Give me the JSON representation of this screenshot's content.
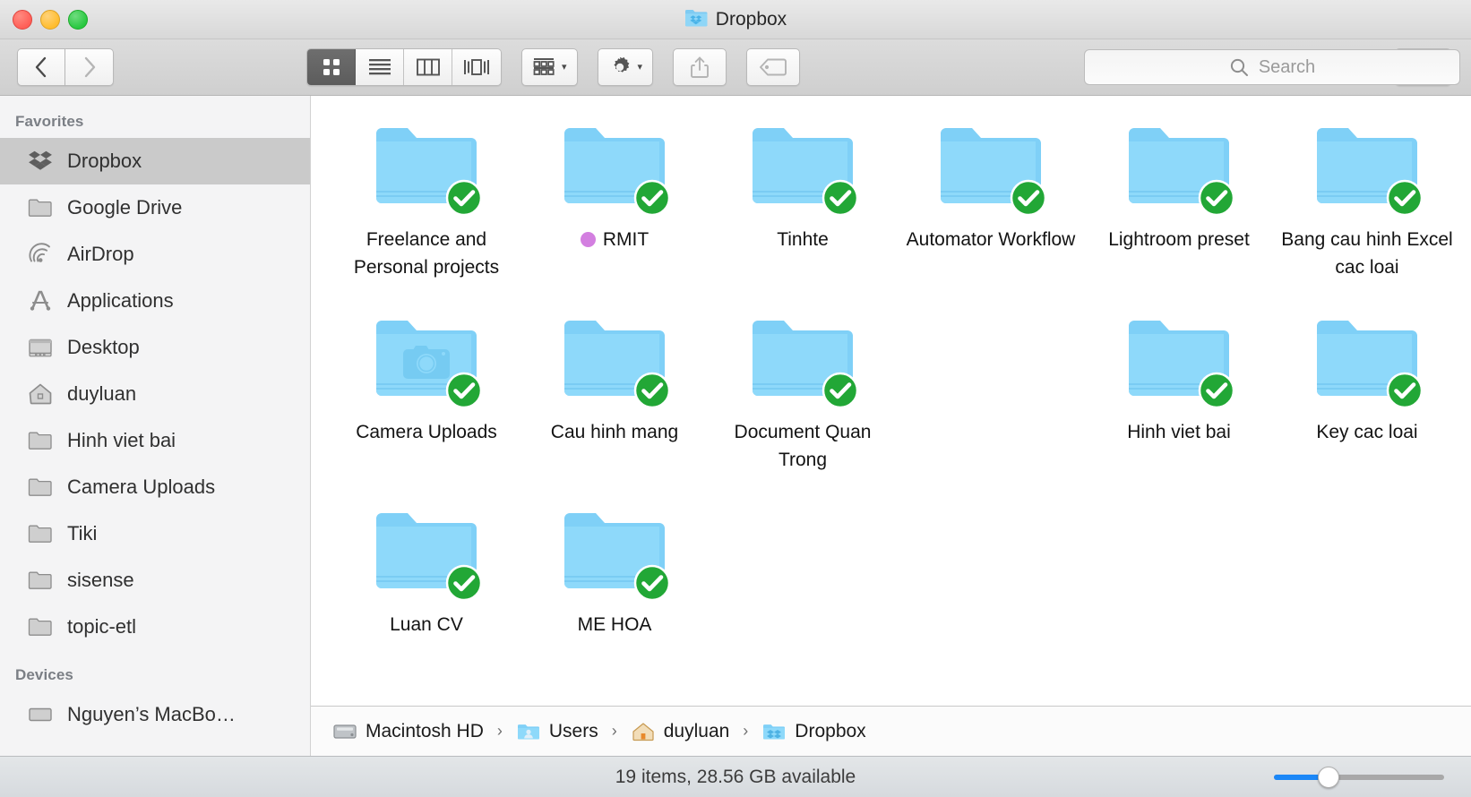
{
  "window": {
    "title": "Dropbox",
    "title_icon": "dropbox-folder-icon",
    "traffic_lights": [
      {
        "name": "close-button",
        "color": "#ff5f57"
      },
      {
        "name": "minimize-button",
        "color": "#ffbd2e"
      },
      {
        "name": "zoom-button",
        "color": "#28c840"
      }
    ]
  },
  "toolbar": {
    "back_icon": "chevron-left-icon",
    "forward_icon": "chevron-right-icon",
    "view_modes": [
      {
        "name": "icon-view",
        "icon": "grid-icon",
        "active": true
      },
      {
        "name": "list-view",
        "icon": "list-icon",
        "active": false
      },
      {
        "name": "column-view",
        "icon": "columns-icon",
        "active": false
      },
      {
        "name": "gallery-view",
        "icon": "gallery-icon",
        "active": false
      }
    ],
    "arrange_icon": "arrange-grid-icon",
    "action_icon": "gear-icon",
    "share_icon": "share-icon",
    "tags_icon": "tag-icon",
    "dropbox_icon": "dropbox-logo-icon",
    "caret_icon": "chevron-down-icon"
  },
  "search": {
    "placeholder": "Search",
    "value": "",
    "icon": "search-icon"
  },
  "sidebar": {
    "sections": [
      {
        "header": "Favorites",
        "items": [
          {
            "label": "Dropbox",
            "icon": "dropbox-logo-icon",
            "selected": true
          },
          {
            "label": "Google Drive",
            "icon": "folder-icon",
            "selected": false
          },
          {
            "label": "AirDrop",
            "icon": "airdrop-icon",
            "selected": false
          },
          {
            "label": "Applications",
            "icon": "applications-icon",
            "selected": false
          },
          {
            "label": "Desktop",
            "icon": "desktop-icon",
            "selected": false
          },
          {
            "label": "duyluan",
            "icon": "home-icon",
            "selected": false
          },
          {
            "label": "Hinh viet bai",
            "icon": "folder-icon",
            "selected": false
          },
          {
            "label": "Camera Uploads",
            "icon": "folder-icon",
            "selected": false
          },
          {
            "label": "Tiki",
            "icon": "folder-icon",
            "selected": false
          },
          {
            "label": "sisense",
            "icon": "folder-icon",
            "selected": false
          },
          {
            "label": "topic-etl",
            "icon": "folder-icon",
            "selected": false
          }
        ]
      },
      {
        "header": "Devices",
        "items": [
          {
            "label": "Nguyen’s MacBo…",
            "icon": "drive-icon",
            "selected": false
          }
        ]
      }
    ]
  },
  "content": {
    "items": [
      {
        "label": "Freelance and Personal projects",
        "badge": "sync-check",
        "tag": null,
        "glyph": null
      },
      {
        "label": "RMIT",
        "badge": "sync-check",
        "tag": "#d37fe0",
        "glyph": null
      },
      {
        "label": "Tinhte",
        "badge": "sync-check",
        "tag": null,
        "glyph": null
      },
      {
        "label": "Automator Workflow",
        "badge": "sync-check",
        "tag": null,
        "glyph": null
      },
      {
        "label": "Lightroom preset",
        "badge": null,
        "tag": null,
        "glyph": null
      },
      {
        "label": "Bang cau hinh Excel cac loai",
        "badge": "sync-check",
        "tag": null,
        "glyph": null
      },
      {
        "label": "Camera Uploads",
        "badge": "sync-check",
        "tag": null,
        "glyph": "camera"
      },
      {
        "label": "Cau hinh mang",
        "badge": "sync-check",
        "tag": null,
        "glyph": null
      },
      {
        "label": "Document Quan Trong",
        "badge": "sync-check",
        "tag": null,
        "glyph": null
      },
      {
        "label": "Hinh viet bai",
        "badge": "sync-check",
        "tag": null,
        "glyph": null
      },
      {
        "label": "Key cac loai",
        "badge": "sync-check",
        "tag": null,
        "glyph": null
      },
      {
        "label": "Luan CV",
        "badge": "sync-check",
        "tag": null,
        "glyph": null
      },
      {
        "label": "ME HOA",
        "badge": "sync-check",
        "tag": null,
        "glyph": null
      }
    ]
  },
  "pathbar": {
    "crumbs": [
      {
        "label": "Macintosh HD",
        "icon": "hard-drive-icon"
      },
      {
        "label": "Users",
        "icon": "users-folder-icon"
      },
      {
        "label": "duyluan",
        "icon": "home-icon"
      },
      {
        "label": "Dropbox",
        "icon": "dropbox-folder-icon"
      }
    ],
    "separator": "›"
  },
  "statusbar": {
    "text": "19 items, 28.56 GB available",
    "zoom_percent": 32
  },
  "colors": {
    "accent": "#1b87f7",
    "folder_blue": "#78cdf5",
    "sync_green": "#22a736",
    "tag_purple": "#d37fe0"
  }
}
